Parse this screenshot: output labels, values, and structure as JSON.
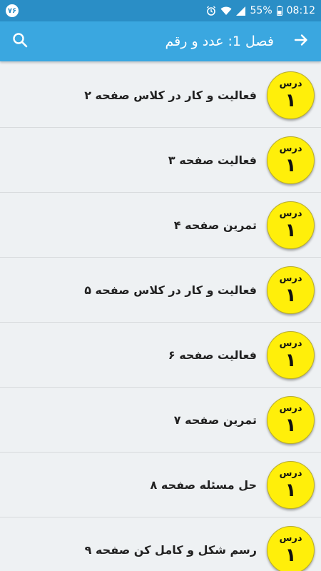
{
  "status_bar": {
    "badge": "٧۶",
    "battery": "55%",
    "time": "08:12"
  },
  "app_bar": {
    "title": "فصل 1: عدد و رقم",
    "search_icon": "search-icon",
    "back_icon": "arrow-right-icon"
  },
  "colors": {
    "status_bar": "#2a8ec6",
    "app_bar": "#3aa7e0",
    "badge": "#ffef0a",
    "background": "#eef1f3"
  },
  "lessons": [
    {
      "title": "فعالیت و کار در کلاس صفحه ۲",
      "badge_label": "درس",
      "badge_number": "۱"
    },
    {
      "title": "فعالیت صفحه ۳",
      "badge_label": "درس",
      "badge_number": "۱"
    },
    {
      "title": "تمرین صفحه ۴",
      "badge_label": "درس",
      "badge_number": "۱"
    },
    {
      "title": "فعالیت و کار در کلاس صفحه ۵",
      "badge_label": "درس",
      "badge_number": "۱"
    },
    {
      "title": "فعالیت صفحه ۶",
      "badge_label": "درس",
      "badge_number": "۱"
    },
    {
      "title": "تمرین صفحه ۷",
      "badge_label": "درس",
      "badge_number": "۱"
    },
    {
      "title": "حل مسئله صفحه ۸",
      "badge_label": "درس",
      "badge_number": "۱"
    },
    {
      "title": "رسم شکل و کامل کن صفحه ۹",
      "badge_label": "درس",
      "badge_number": "۱"
    }
  ]
}
